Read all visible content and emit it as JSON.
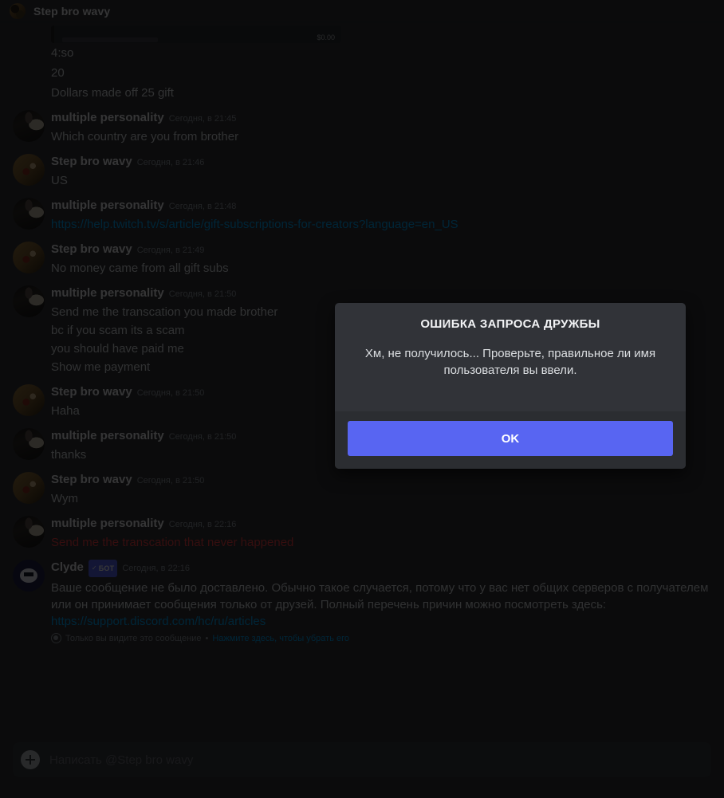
{
  "header": {
    "title": "Step bro wavy",
    "avatar_icon": "user-avatar-step-bro-wavy"
  },
  "embed": {
    "amount": "$0.00"
  },
  "pending_lines": [
    "4:so",
    "20",
    "Dollars made off 25 gift"
  ],
  "messages": [
    {
      "author": "multiple personality",
      "timestamp": "Сегодня, в 21:45",
      "avatar": "a-mp",
      "lines": [
        {
          "text": "Which country are you from brother",
          "style": "normal"
        }
      ]
    },
    {
      "author": "Step bro wavy",
      "timestamp": "Сегодня, в 21:46",
      "avatar": "a-sb",
      "lines": [
        {
          "text": "US",
          "style": "normal"
        }
      ]
    },
    {
      "author": "multiple personality",
      "timestamp": "Сегодня, в 21:48",
      "avatar": "a-mp",
      "lines": [
        {
          "text": "https://help.twitch.tv/s/article/gift-subscriptions-for-creators?language=en_US",
          "style": "link"
        }
      ]
    },
    {
      "author": "Step bro wavy",
      "timestamp": "Сегодня, в 21:49",
      "avatar": "a-sb",
      "lines": [
        {
          "text": "No money came from all gift subs",
          "style": "normal"
        }
      ]
    },
    {
      "author": "multiple personality",
      "timestamp": "Сегодня, в 21:50",
      "avatar": "a-mp",
      "lines": [
        {
          "text": "Send me the transcation you made brother",
          "style": "normal"
        },
        {
          "text": "bc if you scam its a scam",
          "style": "normal"
        },
        {
          "text": "you should have paid me",
          "style": "normal"
        },
        {
          "text": "Show me payment",
          "style": "normal"
        }
      ]
    },
    {
      "author": "Step bro wavy",
      "timestamp": "Сегодня, в 21:50",
      "avatar": "a-sb",
      "lines": [
        {
          "text": "Haha",
          "style": "normal"
        }
      ]
    },
    {
      "author": "multiple personality",
      "timestamp": "Сегодня, в 21:50",
      "avatar": "a-mp",
      "lines": [
        {
          "text": "thanks",
          "style": "normal"
        }
      ]
    },
    {
      "author": "Step bro wavy",
      "timestamp": "Сегодня, в 21:50",
      "avatar": "a-sb",
      "lines": [
        {
          "text": "Wym",
          "style": "normal"
        }
      ]
    },
    {
      "author": "multiple personality",
      "timestamp": "Сегодня, в 22:16",
      "avatar": "a-mp",
      "lines": [
        {
          "text": "Send me the transcation that never happened",
          "style": "failed"
        }
      ]
    }
  ],
  "clyde": {
    "author": "Clyde",
    "bot_badge": "БОТ",
    "bot_badge_check": "✓",
    "timestamp": "Сегодня, в 22:16",
    "text": "Ваше сообщение не было доставлено. Обычно такое случается, потому что у вас нет общих серверов с получателем или он принимает сообщения только от друзей. Полный перечень причин можно посмотреть здесь: ",
    "link": "https://support.discord.com/hc/ru/articles",
    "ephemeral_note": "Только вы видите это сообщение",
    "ephemeral_sep": "•",
    "ephemeral_action": "Нажмите здесь, чтобы убрать его"
  },
  "composer": {
    "placeholder": "Написать @Step bro wavy",
    "add_icon": "plus-circle-icon"
  },
  "modal": {
    "title": "ОШИБКА ЗАПРОСА ДРУЖБЫ",
    "text": "Хм, не получилось... Проверьте, правильное ли имя пользователя вы ввели.",
    "ok_label": "OK",
    "accent_color": "#5865f2",
    "background_color": "#313338",
    "footer_color": "#2b2d31"
  }
}
